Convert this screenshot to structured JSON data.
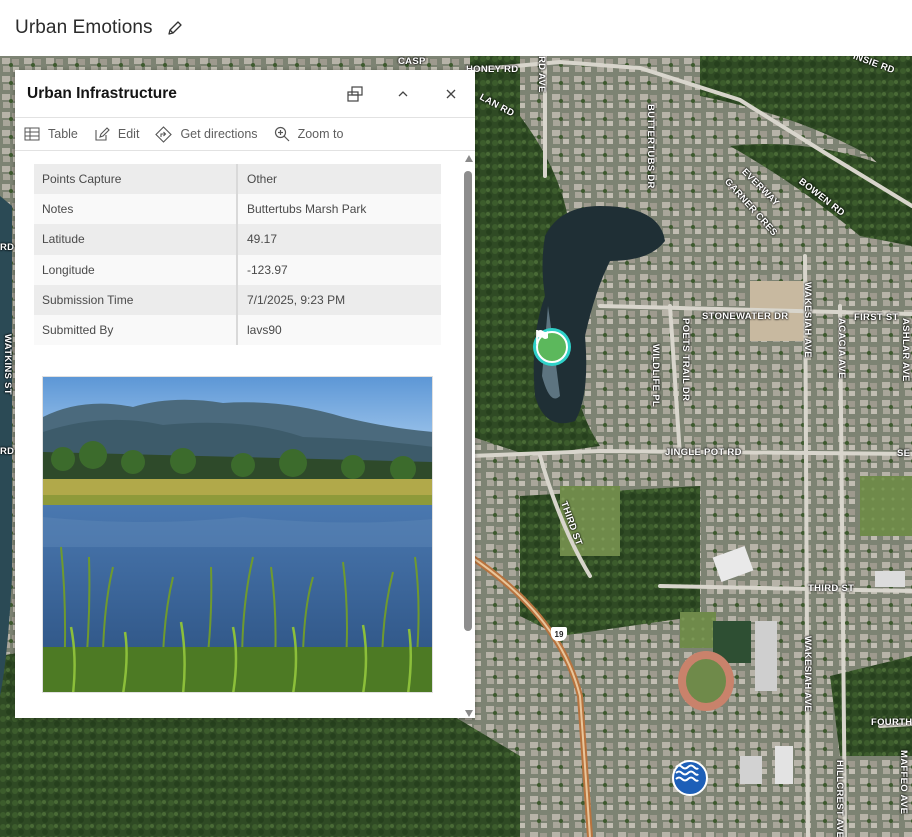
{
  "app": {
    "title": "Urban Emotions",
    "edit_icon": "pencil-icon"
  },
  "popup": {
    "title": "Urban Infrastructure",
    "header_icons": [
      "dock-icon",
      "collapse-chevron-up-icon",
      "close-icon"
    ],
    "toolbar": [
      {
        "label": "Table",
        "icon": "table-icon"
      },
      {
        "label": "Edit",
        "icon": "edit-icon"
      },
      {
        "label": "Get directions",
        "icon": "directions-icon"
      },
      {
        "label": "Zoom to",
        "icon": "zoom-to-icon"
      }
    ],
    "fields": [
      {
        "key": "Points Capture",
        "value": "Other"
      },
      {
        "key": "Notes",
        "value": "Buttertubs Marsh Park"
      },
      {
        "key": "Latitude",
        "value": "49.17"
      },
      {
        "key": "Longitude",
        "value": "-123.97"
      },
      {
        "key": "Submission Time",
        "value": "7/1/2025, 9:23 PM"
      },
      {
        "key": "Submitted By",
        "value": "lavs90"
      }
    ],
    "photo_icon": "marsh-landscape-photo"
  },
  "map": {
    "labels": [
      {
        "id": "caspers",
        "text": "CASP"
      },
      {
        "id": "honey-rd",
        "text": "HONEY RD"
      },
      {
        "id": "lan-rd",
        "text": "LAN RD"
      },
      {
        "id": "rd-ave",
        "text": "RD AVE"
      },
      {
        "id": "buttertubs-dr",
        "text": "BUTTERTUBS DR"
      },
      {
        "id": "jinsie-rd",
        "text": "INSIE RD"
      },
      {
        "id": "ever-way",
        "text": "EVERWAY"
      },
      {
        "id": "bowen-rd",
        "text": "BOWEN RD"
      },
      {
        "id": "garner-cres",
        "text": "GARNER CRES"
      },
      {
        "id": "stonewater-dr",
        "text": "STONEWATER DR"
      },
      {
        "id": "first-st",
        "text": "FIRST ST"
      },
      {
        "id": "wakesiah-ave-top",
        "text": "WAKESIAH AVE"
      },
      {
        "id": "acacia-ave",
        "text": "ACACIA AVE"
      },
      {
        "id": "ashlar-ave",
        "text": "ASHLAR AVE"
      },
      {
        "id": "poets-trail-dr",
        "text": "POETS TRAIL DR"
      },
      {
        "id": "wildlife-pl",
        "text": "WILDLIFE PL"
      },
      {
        "id": "jingle-pot-rd",
        "text": "JINGLE POT RD"
      },
      {
        "id": "se",
        "text": "SE"
      },
      {
        "id": "third-st-left",
        "text": "THIRD ST"
      },
      {
        "id": "third-st-right",
        "text": "THIRD ST"
      },
      {
        "id": "wakesiah-ave-bottom",
        "text": "WAKESIAH AVE"
      },
      {
        "id": "fourth",
        "text": "FOURTH"
      },
      {
        "id": "hillcrest-ave",
        "text": "HILLCREST AVE"
      },
      {
        "id": "maffeo-ave",
        "text": "MAFFEO AVE"
      },
      {
        "id": "watkins-st",
        "text": "WATKINS ST"
      },
      {
        "id": "rd-left",
        "text": "RD"
      },
      {
        "id": "rd-left2",
        "text": "RD"
      }
    ],
    "highway_shield": "19",
    "markers": [
      {
        "name": "flag-marker",
        "icon": "flag-icon",
        "color": "#5cb85c",
        "halo": "#2fd1c8"
      },
      {
        "name": "water-marker",
        "icon": "water-waves-icon",
        "color": "#1d5fb8"
      }
    ]
  }
}
